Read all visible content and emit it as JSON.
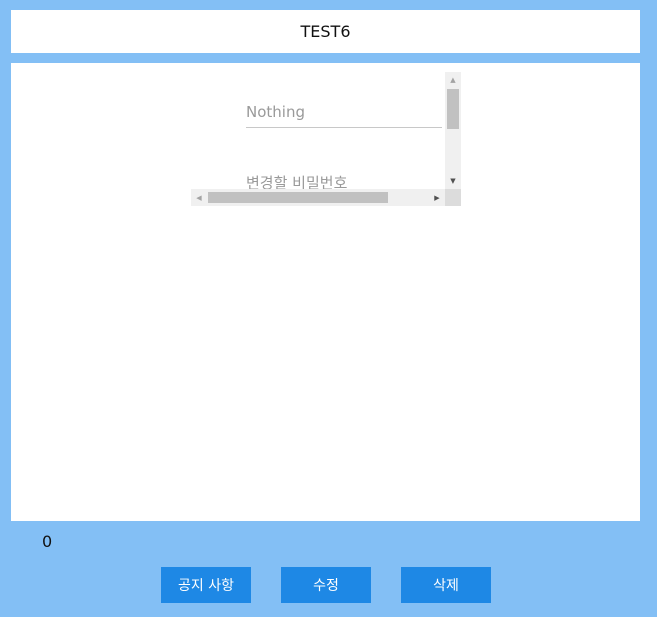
{
  "header": {
    "title": "TEST6"
  },
  "form": {
    "field1_placeholder": "Nothing",
    "field2_placeholder": "변경할 비밀번호"
  },
  "footer": {
    "count": "0",
    "buttons": {
      "notice_label": "공지 사항",
      "edit_label": "수정",
      "delete_label": "삭제"
    }
  },
  "colors": {
    "background": "#83bff5",
    "button": "#1e88e5"
  }
}
